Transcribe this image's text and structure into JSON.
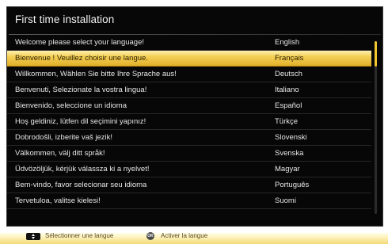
{
  "title": "First time installation",
  "languages": [
    {
      "message": "Welcome please select your language!",
      "language": "English"
    },
    {
      "message": "Bienvenue ! Veuillez choisir une langue.",
      "language": "Français"
    },
    {
      "message": "Willkommen, Wählen Sie bitte Ihre Sprache aus!",
      "language": "Deutsch"
    },
    {
      "message": "Benvenuti, Selezionate la vostra lingua!",
      "language": "Italiano"
    },
    {
      "message": "Bienvenido, seleccione un idioma",
      "language": "Español"
    },
    {
      "message": "Hoş geldiniz, lütfen dil seçimini yapınız!",
      "language": "Türkçe"
    },
    {
      "message": "Dobrodošli, izberite vaš jezik!",
      "language": "Slovenski"
    },
    {
      "message": "Välkommen, välj ditt språk!",
      "language": "Svenska"
    },
    {
      "message": "Üdvözöljük, kérjük válassza ki a nyelvet!",
      "language": "Magyar"
    },
    {
      "message": "Bem-vindo, favor selecionar seu idioma",
      "language": "Português"
    },
    {
      "message": "Tervetuloa, valitse kielesi!",
      "language": "Suomi"
    }
  ],
  "selected_index": 1,
  "footer": {
    "select_hint": "Sélectionner une langue",
    "ok_key": "OK",
    "activate_hint": "Activer la langue"
  },
  "colors": {
    "panel_background": "#070707",
    "highlight": "#f3cf55",
    "scroll_thumb": "#f2c531",
    "text": "#e6e6e6"
  },
  "icons": {
    "nav_key": "up-down-arrows-icon",
    "ok_key": "ok-button-icon"
  }
}
